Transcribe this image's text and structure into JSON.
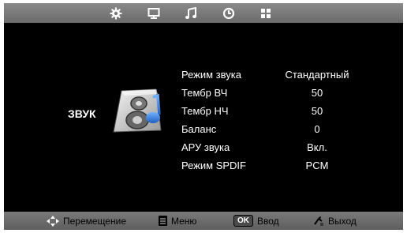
{
  "tabs": [
    {
      "icon": "gear-icon"
    },
    {
      "icon": "monitor-icon"
    },
    {
      "icon": "music-note-icon"
    },
    {
      "icon": "clock-icon"
    },
    {
      "icon": "grid-icon"
    }
  ],
  "section": {
    "title": "ЗВУК",
    "icon": "speaker-icon"
  },
  "settings": [
    {
      "label": "Режим звука",
      "value": "Стандартный"
    },
    {
      "label": "Тембр ВЧ",
      "value": "50"
    },
    {
      "label": "Тембр НЧ",
      "value": "50"
    },
    {
      "label": "Баланс",
      "value": "0"
    },
    {
      "label": "АРУ звука",
      "value": "Вкл."
    },
    {
      "label": "Режим SPDIF",
      "value": "PCM"
    }
  ],
  "hints": [
    {
      "icon": "four-way-arrows-icon",
      "label": "Перемещение"
    },
    {
      "icon": "menu-icon",
      "label": "Меню"
    },
    {
      "icon": "ok-key-icon",
      "key": "OK",
      "label": "Ввод"
    },
    {
      "icon": "exit-icon",
      "label": "Выход"
    }
  ],
  "colors": {
    "background": "#000000",
    "bar": "#7a7a7a",
    "text": "#ffffff",
    "accent": "#3a7bd5"
  }
}
